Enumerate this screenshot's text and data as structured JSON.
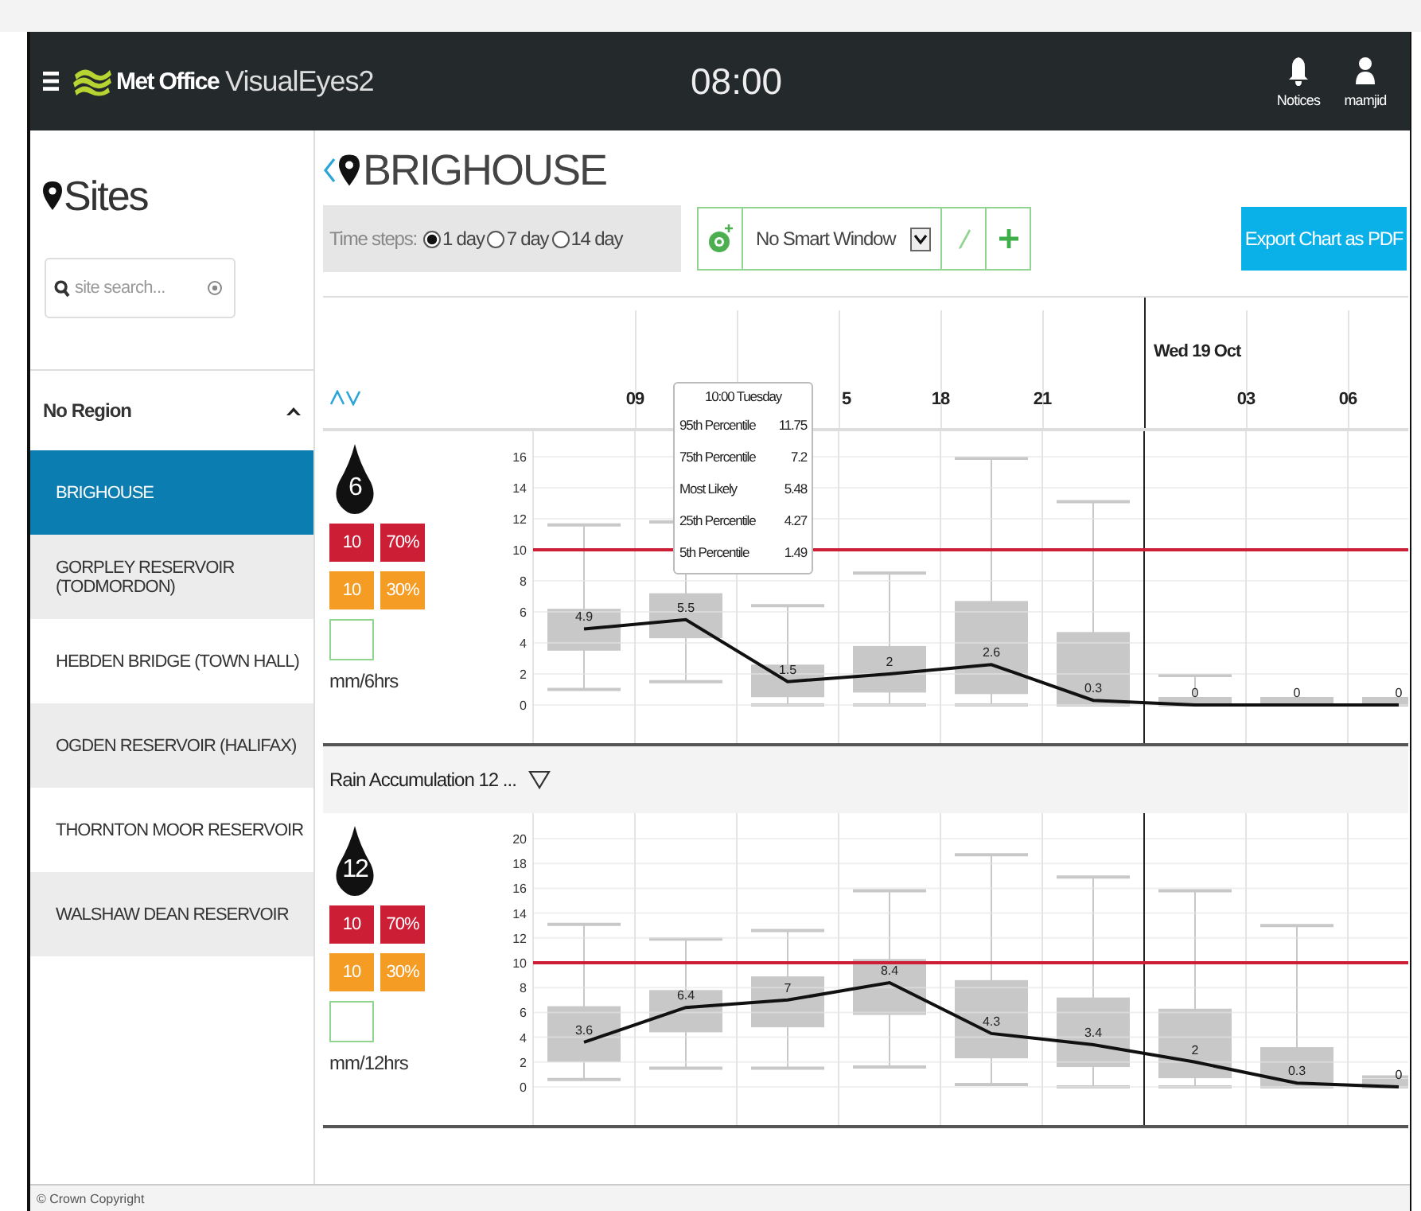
{
  "header": {
    "brand": "Met Office",
    "product": "VisualEyes2",
    "time": "08:00",
    "notices": "Notices",
    "user": "mamjid"
  },
  "sidebar": {
    "title": "Sites",
    "search": {
      "placeholder": "site search..."
    },
    "region": {
      "label": "No Region",
      "expanded": true
    },
    "items": [
      {
        "label": "BRIGHOUSE",
        "selected": true
      },
      {
        "label": "GORPLEY RESERVOIR (TODMORDON)",
        "selected": false
      },
      {
        "label": "HEBDEN BRIDGE (TOWN HALL)",
        "selected": false
      },
      {
        "label": "OGDEN RESERVOIR (HALIFAX)",
        "selected": false
      },
      {
        "label": "THORNTON MOOR RESERVOIR",
        "selected": false
      },
      {
        "label": "WALSHAW DEAN RESERVOIR",
        "selected": false
      }
    ]
  },
  "site_title": "BRIGHOUSE",
  "toolbar": {
    "time_steps_label": "Time steps:",
    "time_steps": [
      {
        "label": "1 day",
        "selected": true
      },
      {
        "label": "7 day",
        "selected": false
      },
      {
        "label": "14 day",
        "selected": false
      }
    ],
    "smart_window": "No Smart Window",
    "export_button": "Export Chart as PDF"
  },
  "time_axis": {
    "ticks": [
      {
        "kind": "time",
        "label": "09"
      },
      {
        "kind": "tooltip"
      },
      {
        "kind": "time",
        "label": "5"
      },
      {
        "kind": "time",
        "label": "18"
      },
      {
        "kind": "time",
        "label": "21"
      },
      {
        "kind": "day",
        "label": "Wed 19 Oct"
      },
      {
        "kind": "time",
        "label": "03"
      },
      {
        "kind": "time",
        "label": "06"
      }
    ]
  },
  "tooltip": {
    "title": "10:00 Tuesday",
    "rows": [
      {
        "label": "95th Percentile",
        "value": "11.75"
      },
      {
        "label": "75th Percentile",
        "value": "7.2"
      },
      {
        "label": "Most Likely",
        "value": "5.48"
      },
      {
        "label": "25th Percentile",
        "value": "4.27"
      },
      {
        "label": "5th Percentile",
        "value": "1.49"
      }
    ]
  },
  "panels": [
    {
      "accumulation": "6",
      "units": "mm/6hrs",
      "thresholds": [
        {
          "value": "10",
          "probability": "70%",
          "color": "#cc1f36"
        },
        {
          "value": "10",
          "probability": "30%",
          "color": "#f59c25"
        }
      ],
      "chart_data": {
        "type": "line",
        "ylim": [
          0,
          16
        ],
        "yticks": [
          0,
          2,
          4,
          6,
          8,
          10,
          12,
          14,
          16
        ],
        "grid": true,
        "values": [
          4.9,
          5.5,
          1.5,
          2,
          2.6,
          0.3,
          0,
          0,
          0
        ],
        "value_labels": [
          "4.9",
          "5.5",
          "1.5",
          "2",
          "2.6",
          "0.3",
          "0",
          "0",
          "0"
        ]
      }
    },
    {
      "title": "Rain Accumulation 12 ...",
      "accumulation": "12",
      "units": "mm/12hrs",
      "thresholds": [
        {
          "value": "10",
          "probability": "70%",
          "color": "#cc1f36"
        },
        {
          "value": "10",
          "probability": "30%",
          "color": "#f59c25"
        }
      ],
      "chart_data": {
        "type": "line",
        "ylim": [
          0,
          20
        ],
        "yticks": [
          0,
          2,
          4,
          6,
          8,
          10,
          12,
          14,
          16,
          18,
          20
        ],
        "grid": true,
        "values": [
          3.6,
          6.4,
          7,
          8.4,
          4.3,
          3.4,
          2,
          0.3,
          0
        ],
        "value_labels": [
          "3.6",
          "6.4",
          "7",
          "8.4",
          "4.3",
          "3.4",
          "2",
          "0.3",
          "0"
        ]
      }
    }
  ],
  "footer": "© Crown Copyright"
}
